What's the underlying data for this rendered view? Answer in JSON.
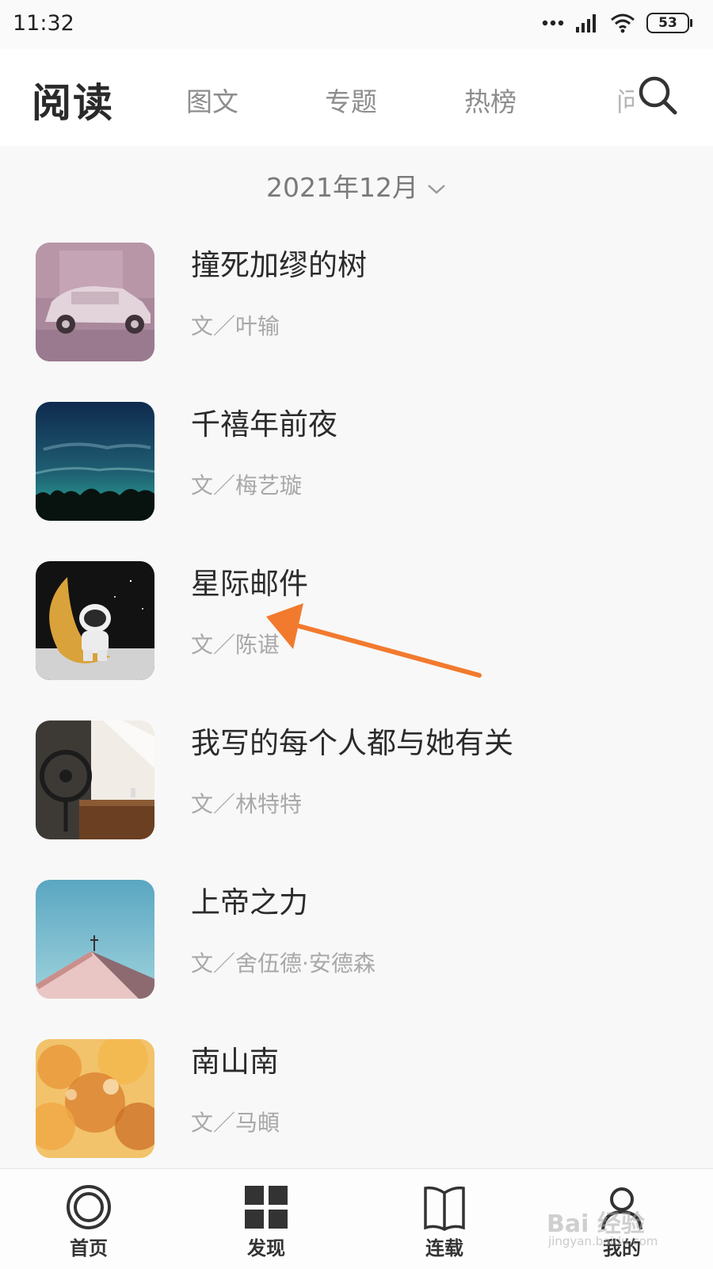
{
  "status_bar": {
    "time": "11:32",
    "battery": "53"
  },
  "header": {
    "title": "阅读",
    "tabs": [
      "图文",
      "专题",
      "热榜"
    ],
    "tab_partial": "问"
  },
  "date_filter": {
    "label": "2021年12月"
  },
  "articles": [
    {
      "title": "撞死加缪的树",
      "author": "文／叶输"
    },
    {
      "title": "千禧年前夜",
      "author": "文／梅艺璇"
    },
    {
      "title": "星际邮件",
      "author": "文／陈谌"
    },
    {
      "title": "我写的每个人都与她有关",
      "author": "文／林特特"
    },
    {
      "title": "上帝之力",
      "author": "文／舍伍德·安德森"
    },
    {
      "title": "南山南",
      "author": "文／马頔"
    }
  ],
  "bottom_nav": [
    "首页",
    "发现",
    "连载",
    "我的"
  ],
  "watermark": {
    "main": "Bai 经验",
    "sub": "jingyan.baidu.com"
  },
  "colors": {
    "accent_arrow": "#f27a2e",
    "tab_inactive": "#8d8d8d",
    "author_text": "#a8a8a8"
  }
}
